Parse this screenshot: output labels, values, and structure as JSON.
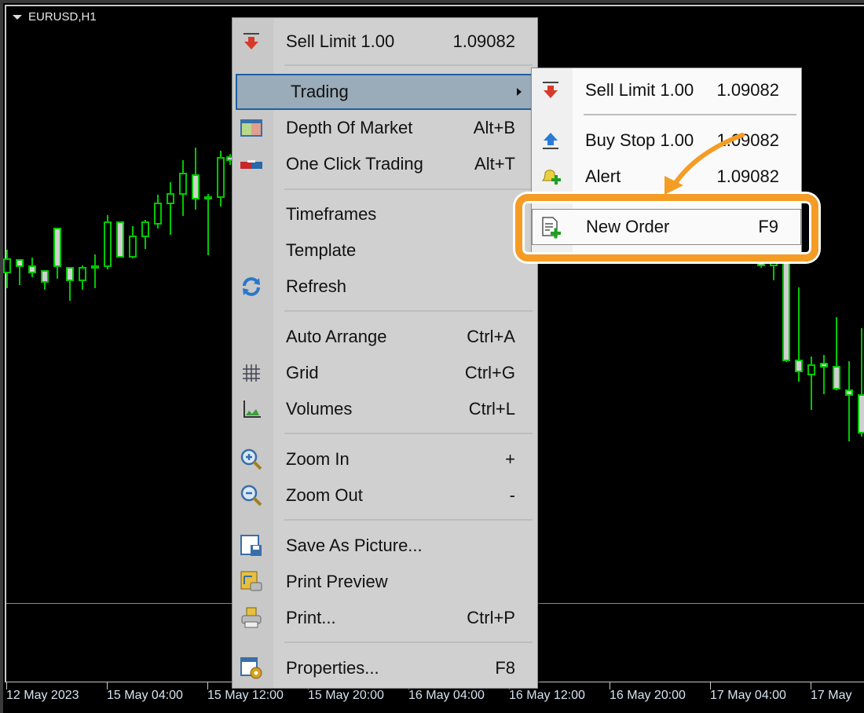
{
  "chart": {
    "symbol": "EURUSD,H1",
    "up_color": "#00c800",
    "body_color": "#d0d0d0",
    "background": "#000000"
  },
  "time_axis": [
    "12 May 2023",
    "15 May 04:00",
    "15 May 12:00",
    "15 May 20:00",
    "16 May 04:00",
    "16 May 12:00",
    "16 May 20:00",
    "17 May 04:00",
    "17 May"
  ],
  "menu": {
    "items": [
      {
        "label": "Sell Limit 1.00",
        "shortcut": "1.09082",
        "icon": "sell-limit-icon"
      },
      {
        "label": "Trading",
        "shortcut": "",
        "icon": "",
        "submenu": true,
        "highlighted": true
      },
      {
        "label": "Depth Of Market",
        "shortcut": "Alt+B",
        "icon": "depth-of-market-icon"
      },
      {
        "label": "One Click Trading",
        "shortcut": "Alt+T",
        "icon": "one-click-trading-icon"
      },
      {
        "label": "Timeframes",
        "shortcut": "",
        "icon": ""
      },
      {
        "label": "Template",
        "shortcut": "",
        "icon": ""
      },
      {
        "label": "Refresh",
        "shortcut": "",
        "icon": "refresh-icon"
      },
      {
        "label": "Auto Arrange",
        "shortcut": "Ctrl+A",
        "icon": ""
      },
      {
        "label": "Grid",
        "shortcut": "Ctrl+G",
        "icon": "grid-icon"
      },
      {
        "label": "Volumes",
        "shortcut": "Ctrl+L",
        "icon": "volumes-icon"
      },
      {
        "label": "Zoom In",
        "shortcut": "+",
        "icon": "zoom-in-icon"
      },
      {
        "label": "Zoom Out",
        "shortcut": "-",
        "icon": "zoom-out-icon"
      },
      {
        "label": "Save As Picture...",
        "shortcut": "",
        "icon": "save-picture-icon"
      },
      {
        "label": "Print Preview",
        "shortcut": "",
        "icon": "print-preview-icon"
      },
      {
        "label": "Print...",
        "shortcut": "Ctrl+P",
        "icon": "print-icon"
      },
      {
        "label": "Properties...",
        "shortcut": "F8",
        "icon": "properties-icon"
      }
    ]
  },
  "submenu": {
    "items": [
      {
        "label": "Sell Limit 1.00",
        "shortcut": "1.09082",
        "icon": "sell-limit-icon"
      },
      {
        "label": "Buy Stop 1.00",
        "shortcut": "1.09082",
        "icon": "buy-stop-icon"
      },
      {
        "label": "Alert",
        "shortcut": "1.09082",
        "icon": "alert-bell-icon"
      },
      {
        "label": "New Order",
        "shortcut": "F9",
        "icon": "new-order-icon",
        "highlighted": true
      }
    ]
  },
  "annotation": {
    "highlight_color": "#f59c25"
  }
}
